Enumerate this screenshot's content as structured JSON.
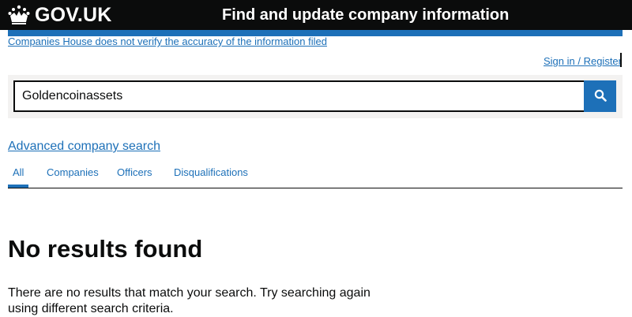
{
  "header": {
    "logo_text": "GOV.UK",
    "logo_icon": "crown-icon",
    "service_name": "Find and update company information"
  },
  "banner": {
    "disclaimer": "Companies House does not verify the accuracy of the information filed"
  },
  "account": {
    "signin_label": "Sign in / Register"
  },
  "search": {
    "value": "Goldencoinassets",
    "button_icon": "search-icon"
  },
  "links": {
    "advanced_search": "Advanced company search"
  },
  "tabs": [
    {
      "label": "All",
      "selected": true
    },
    {
      "label": "Companies",
      "selected": false
    },
    {
      "label": "Officers",
      "selected": false
    },
    {
      "label": "Disqualifications",
      "selected": false
    }
  ],
  "results": {
    "heading": "No results found",
    "message": "There are no results that match your search. Try searching again using different search criteria."
  },
  "colors": {
    "header_bg": "#0b0c0c",
    "link": "#1d70b8",
    "accent_bar": "#1d70b8",
    "panel_bg": "#f3f2f1"
  }
}
